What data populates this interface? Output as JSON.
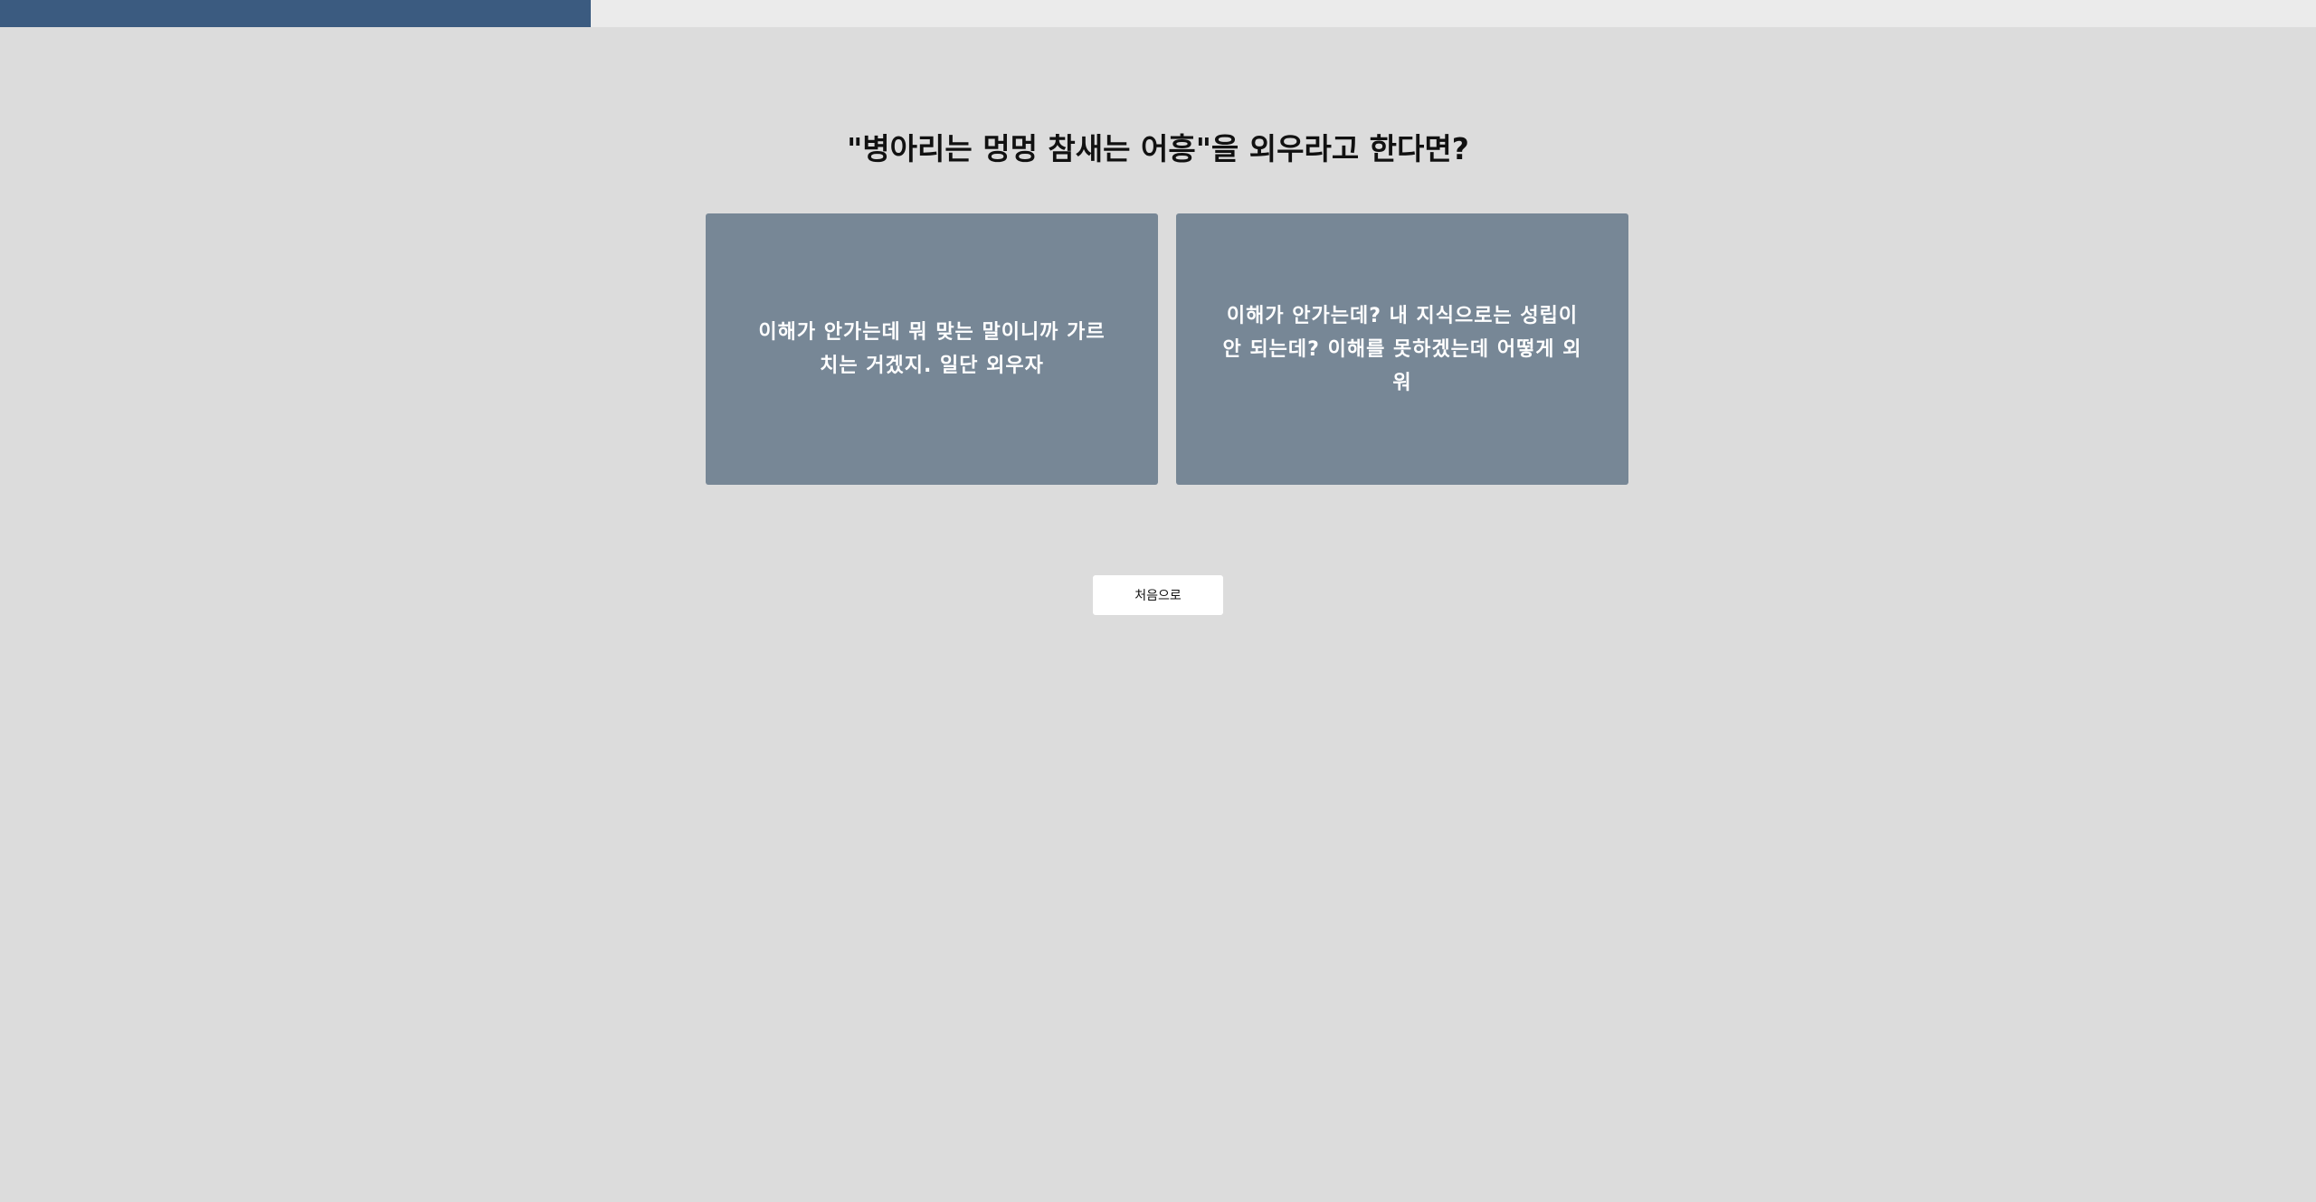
{
  "progress": {
    "fraction": 0.255,
    "fill_color": "#3b5b80",
    "track_color": "#ebebeb"
  },
  "question": {
    "text": "\"병아리는 멍멍 참새는 어흥\"을 외우라고 한다면?"
  },
  "answers": [
    {
      "text": "이해가 안가는데 뭐 맞는 말이니까 가르치는 거겠지. 일단 외우자"
    },
    {
      "text": "이해가 안가는데? 내 지식으로는 성립이 안 되는데? 이해를 못하겠는데 어떻게 외워"
    }
  ],
  "restart": {
    "label": "처음으로"
  },
  "colors": {
    "background": "#dcdcdc",
    "card": "#778796",
    "button": "#ffffff"
  }
}
